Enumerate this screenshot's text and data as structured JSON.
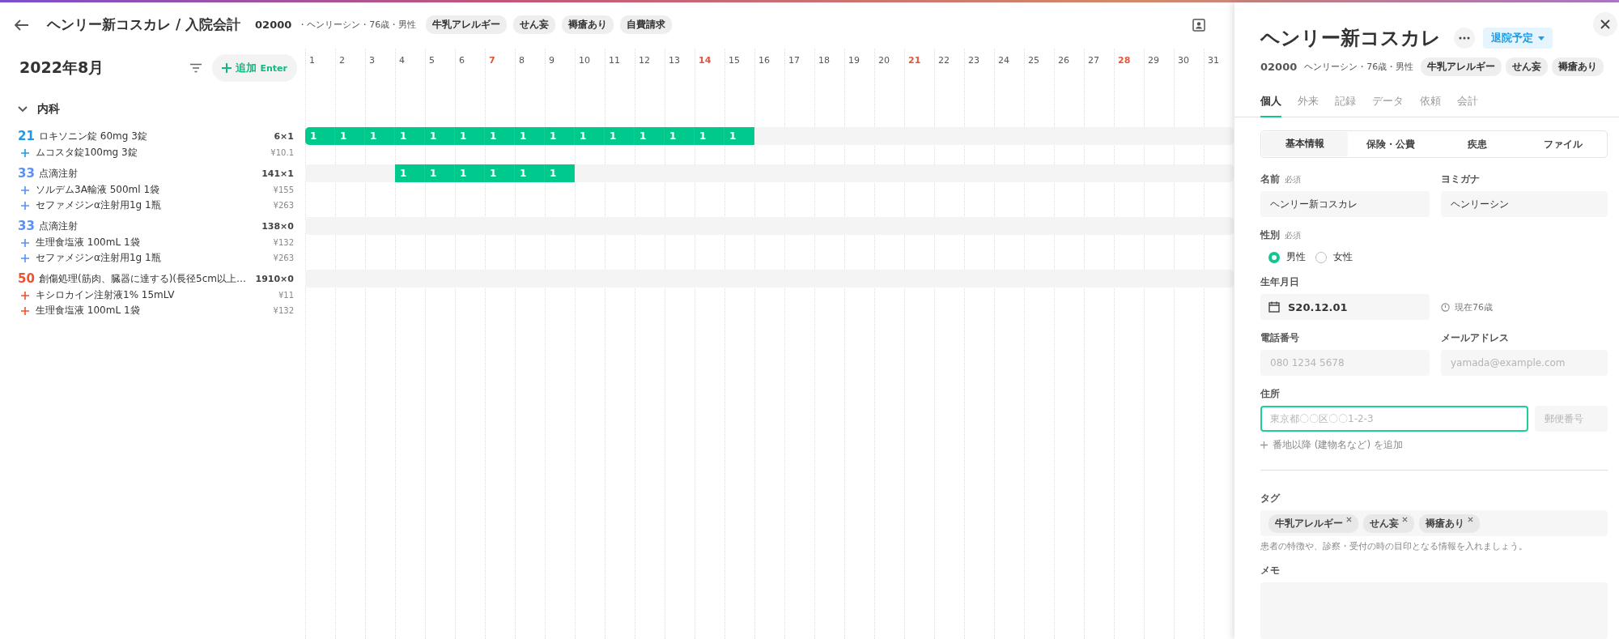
{
  "header": {
    "title": "ヘンリー新コスカレ / 入院会計",
    "patient_id": "02000",
    "patient_meta": "・ヘンリーシン・76歳・男性",
    "tags": [
      "牛乳アレルギー",
      "せん妄",
      "褥瘡あり",
      "自費請求"
    ]
  },
  "toolbar": {
    "month": "2022年8月",
    "add_button": {
      "label": "追加",
      "shortcut": "Enter"
    }
  },
  "days": [
    {
      "label": "1",
      "sunday": false
    },
    {
      "label": "2",
      "sunday": false
    },
    {
      "label": "3",
      "sunday": false
    },
    {
      "label": "4",
      "sunday": false
    },
    {
      "label": "5",
      "sunday": false
    },
    {
      "label": "6",
      "sunday": false
    },
    {
      "label": "7",
      "sunday": true
    },
    {
      "label": "8",
      "sunday": false
    },
    {
      "label": "9",
      "sunday": false
    },
    {
      "label": "10",
      "sunday": false
    },
    {
      "label": "11",
      "sunday": false
    },
    {
      "label": "12",
      "sunday": false
    },
    {
      "label": "13",
      "sunday": false
    },
    {
      "label": "14",
      "sunday": true
    },
    {
      "label": "15",
      "sunday": false
    },
    {
      "label": "16",
      "sunday": false
    },
    {
      "label": "17",
      "sunday": false
    },
    {
      "label": "18",
      "sunday": false
    },
    {
      "label": "19",
      "sunday": false
    },
    {
      "label": "20",
      "sunday": false
    },
    {
      "label": "21",
      "sunday": true
    },
    {
      "label": "22",
      "sunday": false
    },
    {
      "label": "23",
      "sunday": false
    },
    {
      "label": "24",
      "sunday": false
    },
    {
      "label": "25",
      "sunday": false
    },
    {
      "label": "26",
      "sunday": false
    },
    {
      "label": "27",
      "sunday": false
    },
    {
      "label": "28",
      "sunday": true
    },
    {
      "label": "29",
      "sunday": false
    },
    {
      "label": "30",
      "sunday": false
    },
    {
      "label": "31",
      "sunday": false
    }
  ],
  "section": {
    "label": "内科",
    "expanded": true
  },
  "orders": [
    {
      "code": "21",
      "color": "#1e9be8",
      "name": "ロキソニン錠 60mg 3錠",
      "quantity": "6×1",
      "items": [
        {
          "name": "ムコスタ錠100mg 3錠",
          "price": "¥10.1"
        }
      ],
      "cells": [
        {
          "filled": true,
          "value": "1"
        },
        {
          "filled": true,
          "value": "1"
        },
        {
          "filled": true,
          "value": "1"
        },
        {
          "filled": true,
          "value": "1"
        },
        {
          "filled": true,
          "value": "1"
        },
        {
          "filled": true,
          "value": "1"
        },
        {
          "filled": true,
          "value": "1"
        },
        {
          "filled": true,
          "value": "1"
        },
        {
          "filled": true,
          "value": "1"
        },
        {
          "filled": true,
          "value": "1"
        },
        {
          "filled": true,
          "value": "1"
        },
        {
          "filled": true,
          "value": "1"
        },
        {
          "filled": true,
          "value": "1"
        },
        {
          "filled": true,
          "value": "1"
        },
        {
          "filled": true,
          "value": "1"
        },
        {
          "filled": false
        },
        {
          "filled": false
        },
        {
          "filled": false
        },
        {
          "filled": false
        },
        {
          "filled": false
        },
        {
          "filled": false
        },
        {
          "filled": false
        },
        {
          "filled": false
        },
        {
          "filled": false
        },
        {
          "filled": false
        },
        {
          "filled": false
        },
        {
          "filled": false
        },
        {
          "filled": false
        },
        {
          "filled": false
        },
        {
          "filled": false
        },
        {
          "filled": false
        }
      ]
    },
    {
      "code": "33",
      "color": "#5b8ff5",
      "name": "点滴注射",
      "quantity": "141×1",
      "items": [
        {
          "name": "ソルデム3A輸液 500ml 1袋",
          "price": "¥155"
        },
        {
          "name": "セファメジンα注射用1g 1瓶",
          "price": "¥263"
        }
      ],
      "cells": [
        {
          "filled": false
        },
        {
          "filled": false
        },
        {
          "filled": false
        },
        {
          "filled": true,
          "value": "1"
        },
        {
          "filled": true,
          "value": "1"
        },
        {
          "filled": true,
          "value": "1"
        },
        {
          "filled": true,
          "value": "1"
        },
        {
          "filled": true,
          "value": "1"
        },
        {
          "filled": true,
          "value": "1"
        },
        {
          "filled": false
        },
        {
          "filled": false
        },
        {
          "filled": false
        },
        {
          "filled": false
        },
        {
          "filled": false
        },
        {
          "filled": false
        },
        {
          "filled": false
        },
        {
          "filled": false
        },
        {
          "filled": false
        },
        {
          "filled": false
        },
        {
          "filled": false
        },
        {
          "filled": false
        },
        {
          "filled": false
        },
        {
          "filled": false
        },
        {
          "filled": false
        },
        {
          "filled": false
        },
        {
          "filled": false
        },
        {
          "filled": false
        },
        {
          "filled": false
        },
        {
          "filled": false
        },
        {
          "filled": false
        },
        {
          "filled": false
        }
      ]
    },
    {
      "code": "33",
      "color": "#5b8ff5",
      "name": "点滴注射",
      "quantity": "138×0",
      "items": [
        {
          "name": "生理食塩液 100mL 1袋",
          "price": "¥132"
        },
        {
          "name": "セファメジンα注射用1g 1瓶",
          "price": "¥263"
        }
      ],
      "cells": [
        {
          "filled": false
        },
        {
          "filled": false
        },
        {
          "filled": false
        },
        {
          "filled": false
        },
        {
          "filled": false
        },
        {
          "filled": false
        },
        {
          "filled": false
        },
        {
          "filled": false
        },
        {
          "filled": false
        },
        {
          "filled": false
        },
        {
          "filled": false
        },
        {
          "filled": false
        },
        {
          "filled": false
        },
        {
          "filled": false
        },
        {
          "filled": false
        },
        {
          "filled": false
        },
        {
          "filled": false
        },
        {
          "filled": false
        },
        {
          "filled": false
        },
        {
          "filled": false
        },
        {
          "filled": false
        },
        {
          "filled": false
        },
        {
          "filled": false
        },
        {
          "filled": false
        },
        {
          "filled": false
        },
        {
          "filled": false
        },
        {
          "filled": false
        },
        {
          "filled": false
        },
        {
          "filled": false
        },
        {
          "filled": false
        },
        {
          "filled": false
        }
      ]
    },
    {
      "code": "50",
      "color": "#f0522d",
      "name": "創傷処理(筋肉、臓器に達する)(長径5cm以上…",
      "quantity": "1910×0",
      "items": [
        {
          "name": "キシロカイン注射液1% 15mLV",
          "price": "¥11"
        },
        {
          "name": "生理食塩液 100mL 1袋",
          "price": "¥132"
        }
      ],
      "cells": [
        {
          "filled": false
        },
        {
          "filled": false
        },
        {
          "filled": false
        },
        {
          "filled": false
        },
        {
          "filled": false
        },
        {
          "filled": false
        },
        {
          "filled": false
        },
        {
          "filled": false
        },
        {
          "filled": false
        },
        {
          "filled": false
        },
        {
          "filled": false
        },
        {
          "filled": false
        },
        {
          "filled": false
        },
        {
          "filled": false
        },
        {
          "filled": false
        },
        {
          "filled": false
        },
        {
          "filled": false
        },
        {
          "filled": false
        },
        {
          "filled": false
        },
        {
          "filled": false
        },
        {
          "filled": false
        },
        {
          "filled": false
        },
        {
          "filled": false
        },
        {
          "filled": false
        },
        {
          "filled": false
        },
        {
          "filled": false
        },
        {
          "filled": false
        },
        {
          "filled": false
        },
        {
          "filled": false
        },
        {
          "filled": false
        },
        {
          "filled": false
        }
      ]
    }
  ],
  "drawer": {
    "name": "ヘンリー新コスカレ",
    "status": "退院予定",
    "patient_id": "02000",
    "patient_meta": "ヘンリーシン・76歳・男性",
    "tags": [
      "牛乳アレルギー",
      "せん妄",
      "褥瘡あり"
    ],
    "tabs": [
      {
        "label": "個人",
        "selected": true
      },
      {
        "label": "外来",
        "selected": false
      },
      {
        "label": "記録",
        "selected": false
      },
      {
        "label": "データ",
        "selected": false
      },
      {
        "label": "依頼",
        "selected": false
      },
      {
        "label": "会計",
        "selected": false
      }
    ],
    "subtabs": [
      {
        "label": "基本情報",
        "selected": true
      },
      {
        "label": "保険・公費",
        "selected": false
      },
      {
        "label": "疾患",
        "selected": false
      },
      {
        "label": "ファイル",
        "selected": false
      }
    ],
    "form": {
      "name": {
        "label": "名前",
        "required": "必須",
        "value": "ヘンリー新コスカレ"
      },
      "kana": {
        "label": "ヨミガナ",
        "value": "ヘンリーシン"
      },
      "gender": {
        "label": "性別",
        "required": "必須",
        "options": [
          {
            "label": "男性",
            "selected": true
          },
          {
            "label": "女性",
            "selected": false
          }
        ]
      },
      "birth": {
        "label": "生年月日",
        "value": "S20.12.01",
        "age": "現在76歳"
      },
      "phone": {
        "label": "電話番号",
        "placeholder": "080 1234 5678"
      },
      "email": {
        "label": "メールアドレス",
        "placeholder": "yamada@example.com"
      },
      "address": {
        "label": "住所",
        "placeholder": "東京都〇〇区〇〇1-2-3",
        "focused": true,
        "postal_placeholder": "郵便番号",
        "add_link": "番地以降 (建物名など) を追加"
      },
      "tags": {
        "label": "タグ",
        "items": [
          "牛乳アレルギー",
          "せん妄",
          "褥瘡あり"
        ],
        "hint": "患者の特徴や、診察・受付の時の目印となる情報を入れましょう。"
      },
      "memo": {
        "label": "メモ"
      }
    }
  }
}
